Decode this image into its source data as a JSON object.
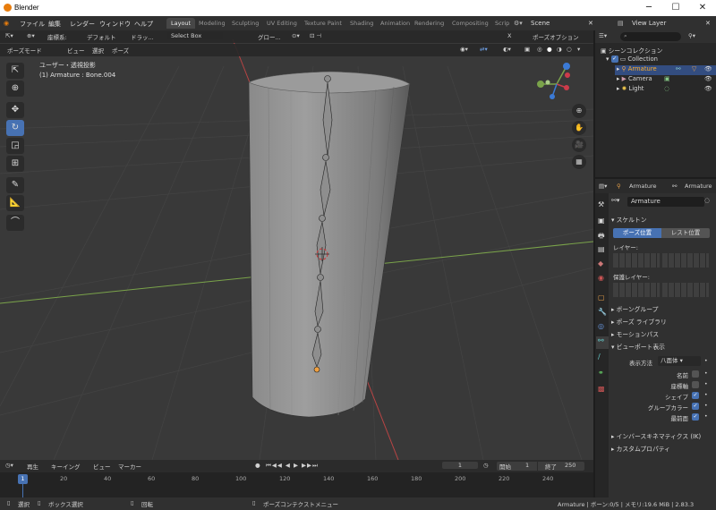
{
  "window": {
    "title": "Blender",
    "minimize": "─",
    "maximize": "☐",
    "close": "✕"
  },
  "menu": {
    "file": "ファイル",
    "edit": "編集",
    "render": "レンダー",
    "window": "ウィンドウ",
    "help": "ヘルプ"
  },
  "workspaces": [
    "Layout",
    "Modeling",
    "Sculpting",
    "UV Editing",
    "Texture Paint",
    "Shading",
    "Animation",
    "Rendering",
    "Compositing",
    "Scrip"
  ],
  "scene": "Scene",
  "view_layer": "View Layer",
  "toolbar": {
    "orientation_label": "座標系:",
    "orientation_value": "デフォルト",
    "drag_label": "ドラッ...",
    "drag_value": "Select Box",
    "global": "グロー...",
    "pose_options": "ポーズオプション"
  },
  "header": {
    "mode": "ポーズモード",
    "view": "ビュー",
    "select": "選択",
    "pose": "ポーズ"
  },
  "viewport_info": {
    "line1": "ユーザー・透視投影",
    "line2": "(1) Armature : Bone.004"
  },
  "outliner": {
    "title": "シーンコレクション",
    "collection": "Collection",
    "items": [
      "Armature",
      "Camera",
      "Light"
    ]
  },
  "properties": {
    "object": "Armature",
    "data": "Armature",
    "datablock": "Armature",
    "skeleton": "スケルトン",
    "pose_position": "ポーズ位置",
    "rest_position": "レスト位置",
    "layers": "レイヤー:",
    "protected_layers": "保護レイヤー:",
    "panels": [
      "ボーングループ",
      "ポーズ ライブラリ",
      "モーションパス"
    ],
    "viewport_display": "ビューポート表示",
    "display_as_label": "表示方法",
    "display_as_value": "八面体",
    "toggles": [
      {
        "label": "名前",
        "on": false
      },
      {
        "label": "座標軸",
        "on": false
      },
      {
        "label": "シェイプ",
        "on": true
      },
      {
        "label": "グループカラー",
        "on": true
      },
      {
        "label": "最前面",
        "on": true
      }
    ],
    "ik": "インバースキネマティクス (IK)",
    "custom_props": "カスタムプロパティ"
  },
  "timeline": {
    "playback": "再生",
    "keying": "キーイング",
    "view": "ビュー",
    "marker": "マーカー",
    "current_frame": "1",
    "start_label": "開始",
    "start": "1",
    "end_label": "終了",
    "end": "250",
    "ticks": [
      "20",
      "40",
      "60",
      "80",
      "100",
      "120",
      "140",
      "160",
      "180",
      "200",
      "220",
      "240"
    ],
    "marker_frame": "1"
  },
  "status": {
    "select": "選択",
    "box_select": "ボックス選択",
    "rotate": "回転",
    "context_menu": "ポーズコンテクストメニュー",
    "info": "Armature | ボーン:0/5 | メモリ:19.6 MiB | 2.83.3"
  }
}
